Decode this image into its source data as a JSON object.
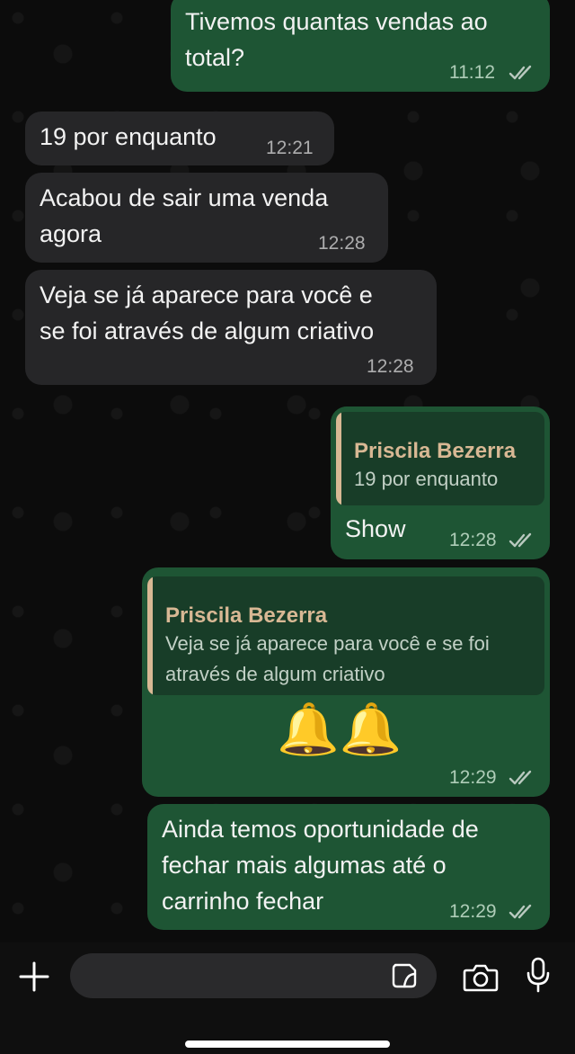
{
  "messages": [
    {
      "direction": "outgoing",
      "lines": [
        "Tivemos quantas vendas ao",
        "total?"
      ],
      "time": "11:12",
      "status": "read"
    },
    {
      "direction": "incoming",
      "lines": [
        "19 por enquanto"
      ],
      "time": "12:21"
    },
    {
      "direction": "incoming",
      "lines": [
        "Acabou de sair uma venda",
        "agora"
      ],
      "time": "12:28"
    },
    {
      "direction": "incoming",
      "lines": [
        "Veja se já aparece para você e",
        "se foi através de algum criativo"
      ],
      "time": "12:28"
    },
    {
      "direction": "outgoing",
      "quote": {
        "author": "Priscila Bezerra",
        "lines": [
          "19 por enquanto"
        ]
      },
      "lines": [
        "Show"
      ],
      "time": "12:28",
      "status": "read"
    },
    {
      "direction": "outgoing",
      "quote": {
        "author": "Priscila Bezerra",
        "lines": [
          "Veja se já aparece para você e se foi",
          "através de algum criativo"
        ]
      },
      "emoji": "🔔🔔",
      "time": "12:29",
      "status": "read"
    },
    {
      "direction": "outgoing",
      "lines": [
        "Ainda temos oportunidade de",
        "fechar mais algumas até o",
        "carrinho fechar"
      ],
      "time": "12:29",
      "status": "read"
    }
  ],
  "composer": {
    "attach_icon": "plus-icon",
    "sticker_icon": "sticker-icon",
    "camera_icon": "camera-icon",
    "mic_icon": "microphone-icon"
  },
  "colors": {
    "incoming_bubble": "#262628",
    "outgoing_bubble": "#1e5534",
    "quote_accent": "#d8b894",
    "read_ticks": "#b9c9bf"
  }
}
